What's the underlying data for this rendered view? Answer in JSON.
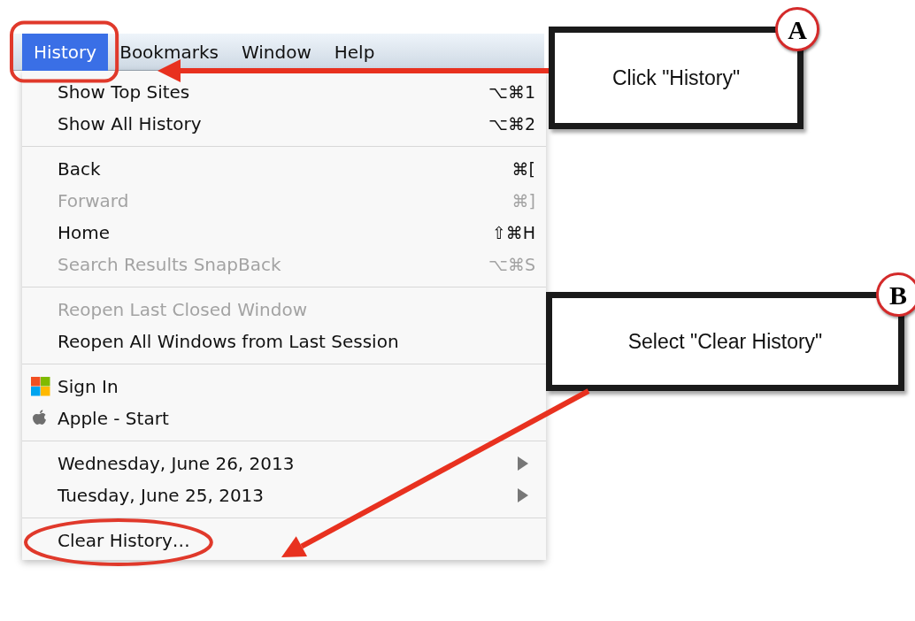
{
  "menubar": [
    {
      "label": "History",
      "selected": true
    },
    {
      "label": "Bookmarks",
      "selected": false
    },
    {
      "label": "Window",
      "selected": false
    },
    {
      "label": "Help",
      "selected": false
    }
  ],
  "menu": {
    "sections": [
      {
        "items": [
          {
            "kind": "plain",
            "label": "Show Top Sites",
            "shortcut": "⌥⌘1",
            "disabled": false
          },
          {
            "kind": "plain",
            "label": "Show All History",
            "shortcut": "⌥⌘2",
            "disabled": false
          }
        ]
      },
      {
        "items": [
          {
            "kind": "plain",
            "label": "Back",
            "shortcut": "⌘[",
            "disabled": false
          },
          {
            "kind": "plain",
            "label": "Forward",
            "shortcut": "⌘]",
            "disabled": true
          },
          {
            "kind": "plain",
            "label": "Home",
            "shortcut": "⇧⌘H",
            "disabled": false
          },
          {
            "kind": "plain",
            "label": "Search Results SnapBack",
            "shortcut": "⌥⌘S",
            "disabled": true
          }
        ]
      },
      {
        "items": [
          {
            "kind": "plain",
            "label": "Reopen Last Closed Window",
            "disabled": true
          },
          {
            "kind": "plain",
            "label": "Reopen All Windows from Last Session",
            "disabled": false
          }
        ]
      },
      {
        "items": [
          {
            "kind": "tiles",
            "label": "Sign In",
            "disabled": false
          },
          {
            "kind": "apple",
            "label": "Apple - Start",
            "disabled": false
          }
        ]
      },
      {
        "items": [
          {
            "kind": "submenu",
            "label": "Wednesday, June 26, 2013",
            "disabled": false
          },
          {
            "kind": "submenu",
            "label": "Tuesday, June 25, 2013",
            "disabled": false
          }
        ]
      },
      {
        "items": [
          {
            "kind": "plain",
            "label": "Clear History…",
            "disabled": false,
            "circled": true
          }
        ]
      }
    ]
  },
  "callouts": [
    {
      "badge": "A",
      "text": "Click \"History\""
    },
    {
      "badge": "B",
      "text": "Select \"Clear History\""
    }
  ]
}
